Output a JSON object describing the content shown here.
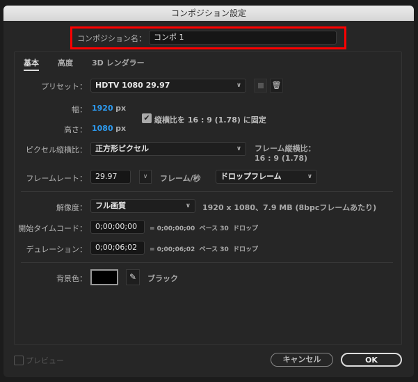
{
  "window": {
    "title": "コンポジション設定"
  },
  "name": {
    "label": "コンポジション名：",
    "value": "コンポ 1"
  },
  "tabs": [
    {
      "label": "基本",
      "active": true
    },
    {
      "label": "高度"
    },
    {
      "label": "3D レンダラー"
    }
  ],
  "preset": {
    "label": "プリセット：",
    "value": "HDTV 1080 29.97"
  },
  "width": {
    "label": "幅：",
    "value": "1920",
    "unit": "px"
  },
  "height": {
    "label": "高さ：",
    "value": "1080",
    "unit": "px"
  },
  "lock_aspect": {
    "label": "縦横比を 16 : 9 (1.78) に固定",
    "checked": true
  },
  "pixel_aspect": {
    "label": "ピクセル縦横比：",
    "value": "正方形ピクセル"
  },
  "frame_aspect": {
    "label": "フレーム縦横比：",
    "value": "16 : 9 (1.78)"
  },
  "frame_rate": {
    "label": "フレームレート：",
    "value": "29.97",
    "unit": "フレーム/秒",
    "mode": "ドロップフレーム"
  },
  "resolution": {
    "label": "解像度：",
    "value": "フル画質",
    "info": "1920 x 1080、7.9 MB (8bpcフレームあたり)"
  },
  "start_timecode": {
    "label": "開始タイムコード：",
    "value": "0;00;00;00",
    "info": "= 0;00;00;00  ベース 30  ドロップ"
  },
  "duration": {
    "label": "デュレーション：",
    "value": "0;00;06;02",
    "info": "= 0;00;06;02  ベース 30  ドロップ"
  },
  "background": {
    "label": "背景色：",
    "color_name": "ブラック",
    "color": "#000000"
  },
  "footer": {
    "preview_label": "プレビュー",
    "cancel_label": "キャンセル",
    "ok_label": "OK"
  },
  "colors": {
    "accent": "#2d9bf0",
    "highlight": "#ff0000"
  }
}
